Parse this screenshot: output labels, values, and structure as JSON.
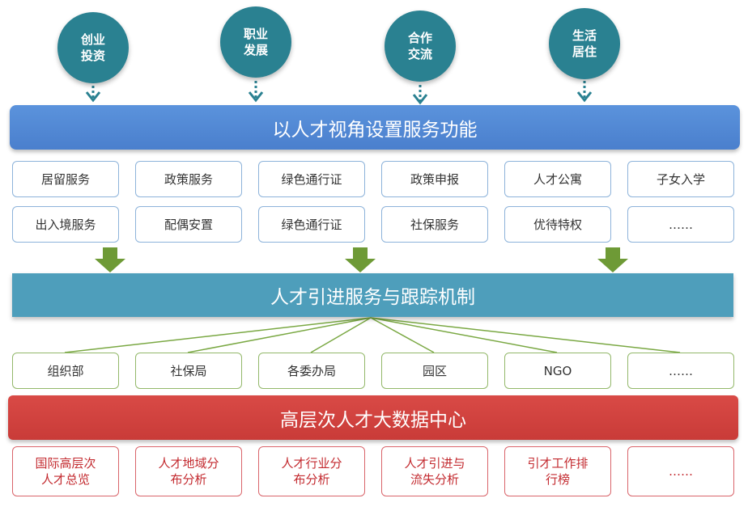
{
  "circles": [
    {
      "label": "创业\n投资"
    },
    {
      "label": "职业\n发展"
    },
    {
      "label": "合作\n交流"
    },
    {
      "label": "生活\n居住"
    }
  ],
  "bands": {
    "top": "以人才视角设置服务功能",
    "middle": "人才引进服务与跟踪机制",
    "bottom": "高层次人才大数据中心"
  },
  "service_rows": [
    [
      "居留服务",
      "政策服务",
      "绿色通行证",
      "政策申报",
      "人才公寓",
      "子女入学"
    ],
    [
      "出入境服务",
      "配偶安置",
      "绿色通行证",
      "社保服务",
      "优待特权",
      "……"
    ]
  ],
  "agencies": [
    "组织部",
    "社保局",
    "各委办局",
    "园区",
    "NGO",
    "……"
  ],
  "data_items": [
    "国际高层次\n人才总览",
    "人才地域分\n布分析",
    "人才行业分\n布分析",
    "人才引进与\n流失分析",
    "引才工作排\n行榜",
    "……"
  ],
  "colors": {
    "circle": "#2a8191",
    "top_band": "#4f88d6",
    "middle_band": "#4e9ebb",
    "bottom_band": "#cf3f3c",
    "arrow_green": "#6e9a36",
    "line_green": "#7aa843"
  }
}
